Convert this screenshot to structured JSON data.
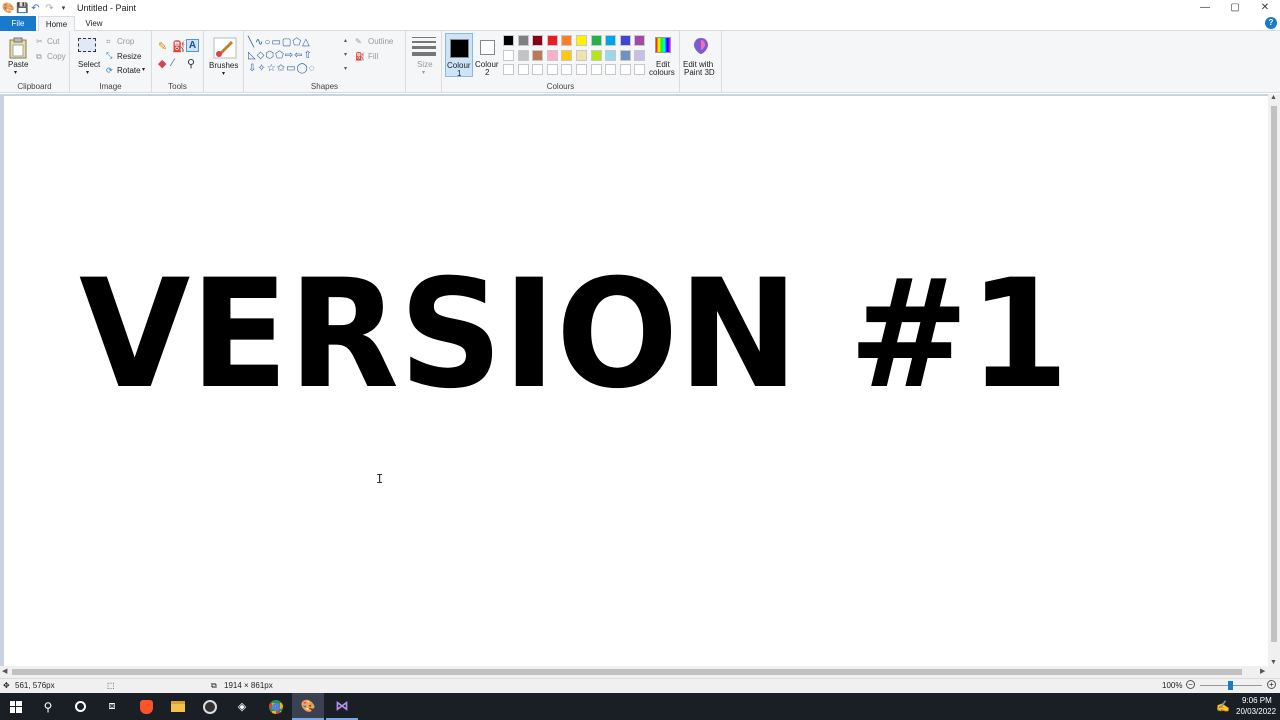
{
  "window": {
    "title": "Untitled - Paint",
    "controls": {
      "minimize": "—",
      "maximize": "▢",
      "close": "✕"
    }
  },
  "tabs": {
    "file": "File",
    "home": "Home",
    "view": "View",
    "help": "?"
  },
  "ribbon": {
    "clipboard": {
      "label": "Clipboard",
      "paste": "Paste",
      "cut": "Cut",
      "copy": "Copy"
    },
    "image": {
      "label": "Image",
      "select": "Select",
      "crop": "Crop",
      "resize": "Resize",
      "rotate": "Rotate"
    },
    "tools": {
      "label": "Tools"
    },
    "brushes": {
      "label": "Brushes"
    },
    "shapes": {
      "label": "Shapes",
      "outline": "Outline",
      "fill": "Fill"
    },
    "size": {
      "label": "Size"
    },
    "colours": {
      "label": "Colours",
      "colour1": "Colour\n1",
      "colour1_line1": "Colour",
      "colour1_line2": "1",
      "colour2_line1": "Colour",
      "colour2_line2": "2",
      "edit_line1": "Edit",
      "edit_line2": "colours",
      "palette_row1": [
        "#000000",
        "#7f7f7f",
        "#880015",
        "#ed1c24",
        "#ff7f27",
        "#fff200",
        "#22b14c",
        "#00a2e8",
        "#3f48cc",
        "#a349a4"
      ],
      "palette_row2": [
        "#ffffff",
        "#c3c3c3",
        "#b97a57",
        "#ffaec9",
        "#ffc90e",
        "#efe4b0",
        "#b5e61d",
        "#99d9ea",
        "#7092be",
        "#c8bfe7"
      ],
      "primary_colour": "#000000",
      "secondary_colour": "#ffffff"
    },
    "paint3d": {
      "line1": "Edit with",
      "line2": "Paint 3D"
    }
  },
  "canvas": {
    "text": "VERSION #1",
    "text_colour": "#000000"
  },
  "status": {
    "cursor_position": "561, 576px",
    "image_size": "1914 × 861px",
    "zoom": "100%"
  },
  "taskbar": {
    "time": "9:06 PM",
    "date": "20/03/2022"
  }
}
